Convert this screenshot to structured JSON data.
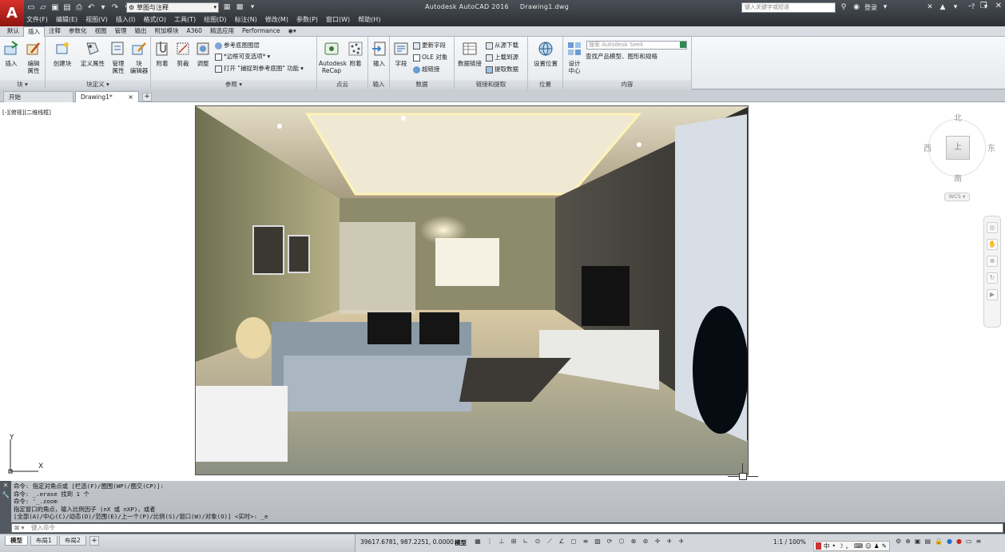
{
  "titlebar": {
    "logo_letter": "A",
    "workspace": "草图与注释",
    "app_name": "Autodesk AutoCAD 2016",
    "doc_name": "Drawing1.dwg",
    "search_placeholder": "键入关键字或短语",
    "login": "登录",
    "help": "?"
  },
  "menu": [
    "文件(F)",
    "编辑(E)",
    "视图(V)",
    "插入(I)",
    "格式(O)",
    "工具(T)",
    "绘图(D)",
    "标注(N)",
    "修改(M)",
    "参数(P)",
    "窗口(W)",
    "帮助(H)"
  ],
  "ribbon_tabs": [
    "默认",
    "插入",
    "注释",
    "参数化",
    "视图",
    "管理",
    "输出",
    "附加模块",
    "A360",
    "精选应用",
    "Performance"
  ],
  "ribbon_active_tab": "插入",
  "ribbon": {
    "block": {
      "title": "块 ▾",
      "insert": "插入",
      "edit_attr_1": "编辑",
      "edit_attr_2": "属性"
    },
    "block_def": {
      "title": "块定义 ▾",
      "create": "创建块",
      "define_attr": "定义属性",
      "manage_attr_1": "管理",
      "manage_attr_2": "属性",
      "block_editor_1": "块",
      "block_editor_2": "编辑器"
    },
    "reference": {
      "title": "参照 ▾",
      "attach": "附着",
      "clip": "剪裁",
      "adjust": "调整",
      "underlay_layers": "参考底图图层",
      "frames": "*边框可变选项*",
      "snap_underlay": "打开 \"捕捉到参考底图\" 功能"
    },
    "point_cloud": {
      "title": "点云",
      "recap_1": "Autodesk",
      "recap_2": "ReCap",
      "attach": "附着"
    },
    "import": {
      "title": "输入",
      "import": "输入"
    },
    "data": {
      "title": "数据",
      "field": "字段",
      "update_fields": "更新字段",
      "ole": "OLE 对象",
      "hyperlink": "超链接"
    },
    "linking": {
      "title": "链接和提取",
      "data_link": "数据链接",
      "download_source": "从源下载",
      "upload_source": "上载到源",
      "extract_data": "提取数据"
    },
    "location": {
      "title": "位置",
      "set_location": "设置位置"
    },
    "content": {
      "title": "内容",
      "design_center_1": "设计",
      "design_center_2": "中心",
      "seek_placeholder": "搜索 Autodesk Seek",
      "seek_desc": "查找产品模型、图形和规格"
    }
  },
  "doc_tabs": {
    "start": "开始",
    "drawing": "Drawing1*",
    "close": "×",
    "add": "+"
  },
  "viewport": {
    "label": "[-][俯视][二维线框]"
  },
  "viewcube": {
    "north": "北",
    "south": "南",
    "east": "东",
    "west": "西",
    "top": "上",
    "wcs": "WCS ▾"
  },
  "ucs": {
    "x": "X",
    "y": "Y"
  },
  "command": {
    "history": [
      "命令: 指定对角点或 [栏选(F)/圈围(WP)/圈交(CP)]:",
      "命令: _.erase 找到 1 个",
      "命令: '_.zoom",
      "指定窗口的角点，输入比例因子 (nX 或 nXP)，或者",
      "[全部(A)/中心(C)/动态(D)/范围(E)/上一个(P)/比例(S)/窗口(W)/对象(O)] <实时>: _e"
    ],
    "prompt_prefix": "⊠ ▾",
    "placeholder": "键入命令"
  },
  "status": {
    "layout_tabs": [
      "模型",
      "布局1",
      "布局2"
    ],
    "add_layout": "+",
    "coordinates": "39617.6781, 987.2251, 0.0000",
    "space": "模型",
    "scale": "1:1 / 100%",
    "ime": "中"
  },
  "colors": {
    "accent_red": "#c8281f",
    "titlebar": "#3a3f45",
    "ribbon": "#eef0f3"
  }
}
